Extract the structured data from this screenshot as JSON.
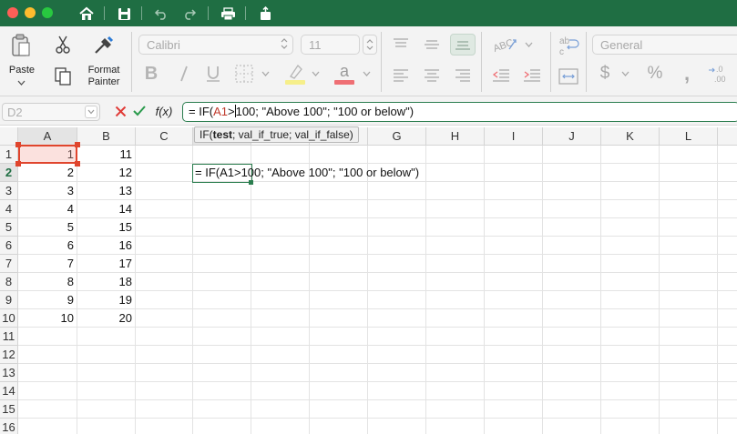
{
  "toolbar": {
    "icons": [
      "home-icon",
      "save-icon",
      "undo-icon",
      "redo-icon",
      "print-icon",
      "share-icon"
    ]
  },
  "ribbon": {
    "paste_label": "Paste",
    "format_painter_label": "Format\nPainter",
    "font_name": "Calibri",
    "font_size": "11",
    "number_format": "General"
  },
  "formula_bar": {
    "name_box": "D2",
    "fx_label": "f(x)",
    "formula_prefix": "= IF(",
    "formula_ref": "A1",
    "formula_op": ">",
    "formula_rest": "100; \"Above 100\"; \"100 or below\")",
    "tooltip_func": "IF(",
    "tooltip_bold": "test",
    "tooltip_rest": "; val_if_true; val_if_false)"
  },
  "grid": {
    "columns": [
      "A",
      "B",
      "C",
      "D",
      "E",
      "F",
      "G",
      "H",
      "I",
      "J",
      "K",
      "L"
    ],
    "rows": [
      "1",
      "2",
      "3",
      "4",
      "5",
      "6",
      "7",
      "8",
      "9",
      "10",
      "11",
      "12",
      "13",
      "14",
      "15",
      "16"
    ],
    "colA": [
      "1",
      "2",
      "3",
      "4",
      "5",
      "6",
      "7",
      "8",
      "9",
      "10"
    ],
    "colB": [
      "11",
      "12",
      "13",
      "14",
      "15",
      "16",
      "17",
      "18",
      "19",
      "20"
    ],
    "edit_text": "= IF(A1>100; \"Above 100\"; \"100 or below\")"
  },
  "colors": {
    "titlebar": "#1f6e43",
    "accent": "#2a7d4e",
    "reference": "#e0452d"
  }
}
